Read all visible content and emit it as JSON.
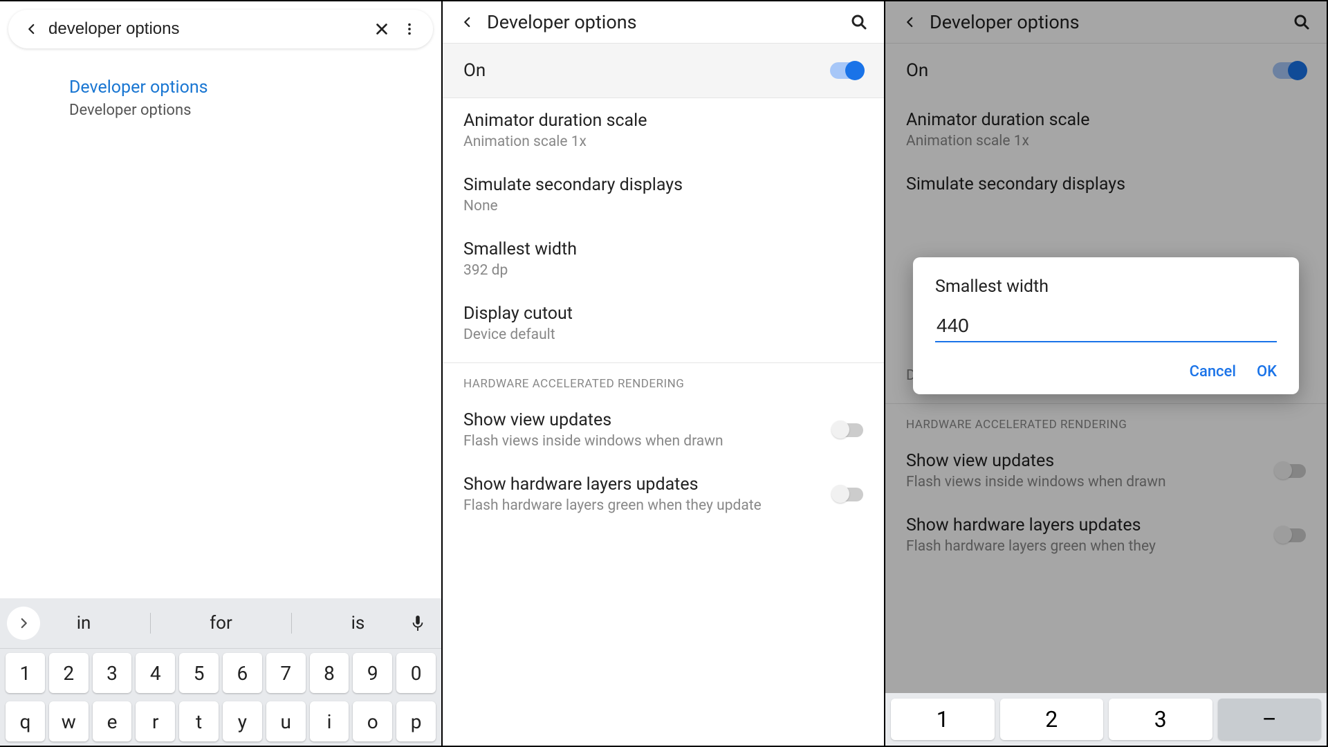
{
  "panel1": {
    "search": {
      "value": "developer options"
    },
    "result": {
      "title": "Developer options",
      "sub": "Developer options"
    },
    "keyboard": {
      "suggestions": [
        "in",
        "for",
        "is"
      ],
      "row1": [
        "1",
        "2",
        "3",
        "4",
        "5",
        "6",
        "7",
        "8",
        "9",
        "0"
      ],
      "row2": [
        "q",
        "w",
        "e",
        "r",
        "t",
        "y",
        "u",
        "i",
        "o",
        "p"
      ]
    }
  },
  "panel2": {
    "title": "Developer options",
    "toggle_label": "On",
    "items": [
      {
        "title": "Animator duration scale",
        "sub": "Animation scale 1x"
      },
      {
        "title": "Simulate secondary displays",
        "sub": "None"
      },
      {
        "title": "Smallest width",
        "sub": "392 dp"
      },
      {
        "title": "Display cutout",
        "sub": "Device default"
      }
    ],
    "section": "HARDWARE ACCELERATED RENDERING",
    "toggle_items": [
      {
        "title": "Show view updates",
        "sub": "Flash views inside windows when drawn"
      },
      {
        "title": "Show hardware layers updates",
        "sub": "Flash hardware layers green when they update"
      }
    ]
  },
  "panel3": {
    "title": "Developer options",
    "toggle_label": "On",
    "items": [
      {
        "title": "Animator duration scale",
        "sub": "Animation scale 1x"
      },
      {
        "title": "Simulate secondary displays",
        "sub": ""
      }
    ],
    "cutout_sub": "Device default",
    "section": "HARDWARE ACCELERATED RENDERING",
    "toggle_items": [
      {
        "title": "Show view updates",
        "sub": "Flash views inside windows when drawn"
      },
      {
        "title": "Show hardware layers updates",
        "sub": "Flash hardware layers green when they"
      }
    ],
    "dialog": {
      "title": "Smallest width",
      "value": "440",
      "cancel": "Cancel",
      "ok": "OK"
    },
    "numkeys": [
      "1",
      "2",
      "3",
      "–"
    ]
  }
}
